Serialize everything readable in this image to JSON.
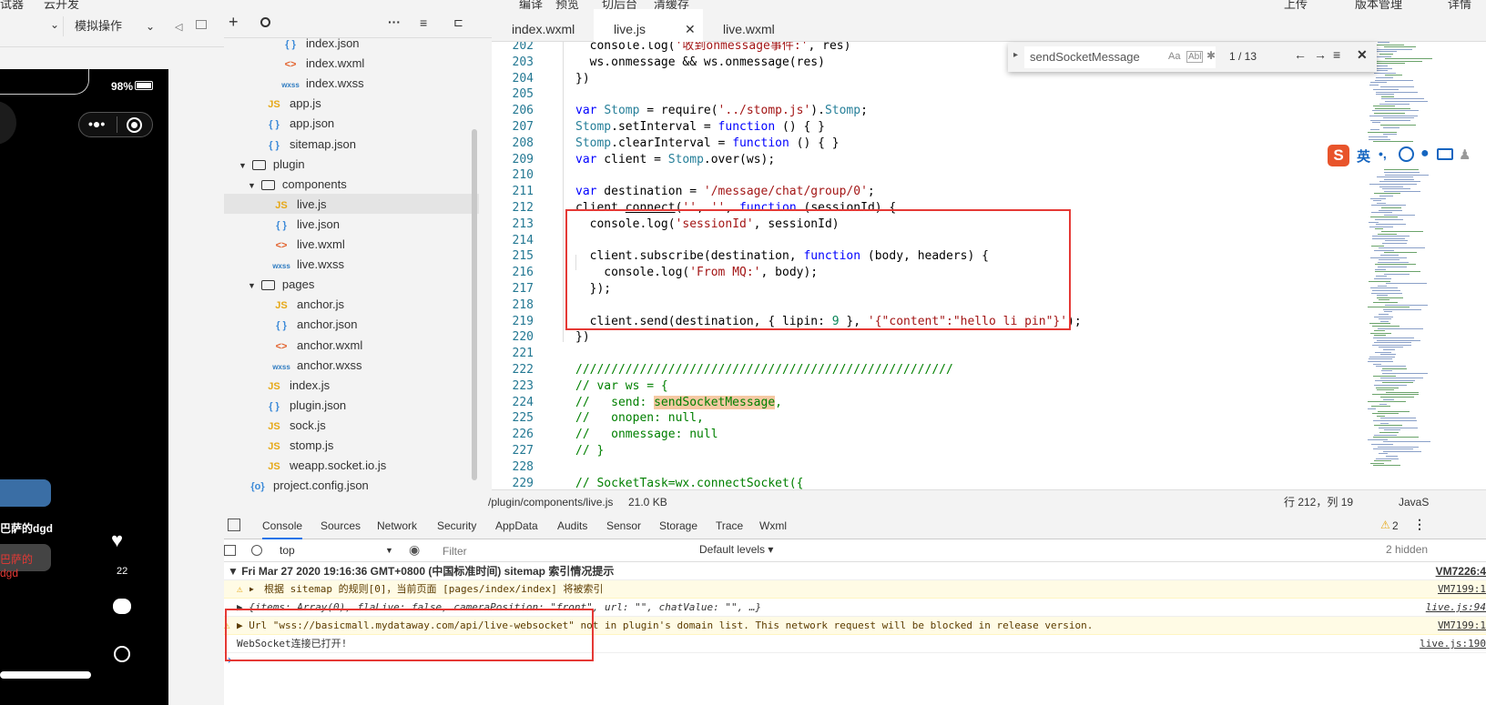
{
  "topbar": {
    "items": [
      "试器",
      "云开发",
      "编译",
      "预览",
      "切后台",
      "清缓存",
      "上传",
      "版本管理",
      "详情"
    ]
  },
  "simulator": {
    "device_select": "",
    "mode_select": "模拟操作",
    "battery": "98%",
    "likes": "22",
    "comment1": "巴萨的dgd",
    "comment2": "巴萨的dgd"
  },
  "tree": {
    "items": [
      {
        "icon": "{ }",
        "type": "json",
        "label": "index.json",
        "indent": 62
      },
      {
        "icon": "<>",
        "type": "wxml",
        "label": "index.wxml",
        "indent": 62
      },
      {
        "icon": "wxss",
        "type": "wxss",
        "label": "index.wxss",
        "indent": 62
      },
      {
        "icon": "JS",
        "type": "js",
        "label": "app.js",
        "indent": 44
      },
      {
        "icon": "{ }",
        "type": "json",
        "label": "app.json",
        "indent": 44
      },
      {
        "icon": "{ }",
        "type": "json",
        "label": "sitemap.json",
        "indent": 44
      },
      {
        "icon": "folder",
        "type": "folder",
        "label": "plugin",
        "indent": 16
      },
      {
        "icon": "folder",
        "type": "folder",
        "label": "components",
        "indent": 26
      },
      {
        "icon": "JS",
        "type": "js",
        "label": "live.js",
        "indent": 52
      },
      {
        "icon": "{ }",
        "type": "json",
        "label": "live.json",
        "indent": 52
      },
      {
        "icon": "<>",
        "type": "wxml",
        "label": "live.wxml",
        "indent": 52
      },
      {
        "icon": "wxss",
        "type": "wxss",
        "label": "live.wxss",
        "indent": 52
      },
      {
        "icon": "folder",
        "type": "folder",
        "label": "pages",
        "indent": 26
      },
      {
        "icon": "JS",
        "type": "js",
        "label": "anchor.js",
        "indent": 52
      },
      {
        "icon": "{ }",
        "type": "json",
        "label": "anchor.json",
        "indent": 52
      },
      {
        "icon": "<>",
        "type": "wxml",
        "label": "anchor.wxml",
        "indent": 52
      },
      {
        "icon": "wxss",
        "type": "wxss",
        "label": "anchor.wxss",
        "indent": 52
      },
      {
        "icon": "JS",
        "type": "js",
        "label": "index.js",
        "indent": 44
      },
      {
        "icon": "{ }",
        "type": "json",
        "label": "plugin.json",
        "indent": 44
      },
      {
        "icon": "JS",
        "type": "js",
        "label": "sock.js",
        "indent": 44
      },
      {
        "icon": "JS",
        "type": "js",
        "label": "stomp.js",
        "indent": 44
      },
      {
        "icon": "JS",
        "type": "js",
        "label": "weapp.socket.io.js",
        "indent": 44
      },
      {
        "icon": "{o}",
        "type": "json",
        "label": "project.config.json",
        "indent": 26
      }
    ]
  },
  "editor": {
    "tabs": [
      "index.wxml",
      "live.js",
      "live.wxml"
    ],
    "find": {
      "value": "sendSocketMessage",
      "count": "1 / 13",
      "aa": "Aa",
      "ab": "Abl"
    },
    "lines": [
      "202",
      "203",
      "204",
      "205",
      "206",
      "207",
      "208",
      "209",
      "210",
      "211",
      "212",
      "213",
      "214",
      "215",
      "216",
      "217",
      "218",
      "219",
      "220",
      "221",
      "222",
      "223",
      "224",
      "225",
      "226",
      "227",
      "228",
      "229"
    ]
  },
  "status": {
    "path": "/plugin/components/live.js",
    "size": "21.0 KB",
    "cursor": "行 212，列 19",
    "lang": "JavaS"
  },
  "ime": {
    "lang": "英"
  },
  "devtools": {
    "tabs": [
      "Console",
      "Sources",
      "Network",
      "Security",
      "AppData",
      "Audits",
      "Sensor",
      "Storage",
      "Trace",
      "Wxml"
    ],
    "warn_count": "2",
    "context": "top",
    "filter_placeholder": "Filter",
    "levels": "Default levels",
    "hidden": "2 hidden"
  },
  "console": {
    "rows": [
      {
        "text": "▼ Fri Mar 27 2020 19:16:36 GMT+0800 (中国标准时间) sitemap 索引情况提示",
        "src": "VM7226:4",
        "kind": "group"
      },
      {
        "text": "根据 sitemap 的规则[0]，当前页面 [pages/index/index] 将被索引",
        "src": "VM7199:1",
        "kind": "warn"
      },
      {
        "text": "▶ {items: Array(0), flaLive: false, cameraPosition: \"front\", url: \"\", chatValue: \"\", …}",
        "src": "live.js:94",
        "kind": "log"
      },
      {
        "text": "▶ Url \"wss://basicmall.mydataway.com/api/live-websocket\" not in plugin's domain list. This network request will be blocked in release version.",
        "src": "VM7199:1",
        "kind": "warn"
      },
      {
        "text": "WebSocket连接已打开!",
        "src": "live.js:190",
        "kind": "log"
      }
    ],
    "prompt": "›"
  }
}
